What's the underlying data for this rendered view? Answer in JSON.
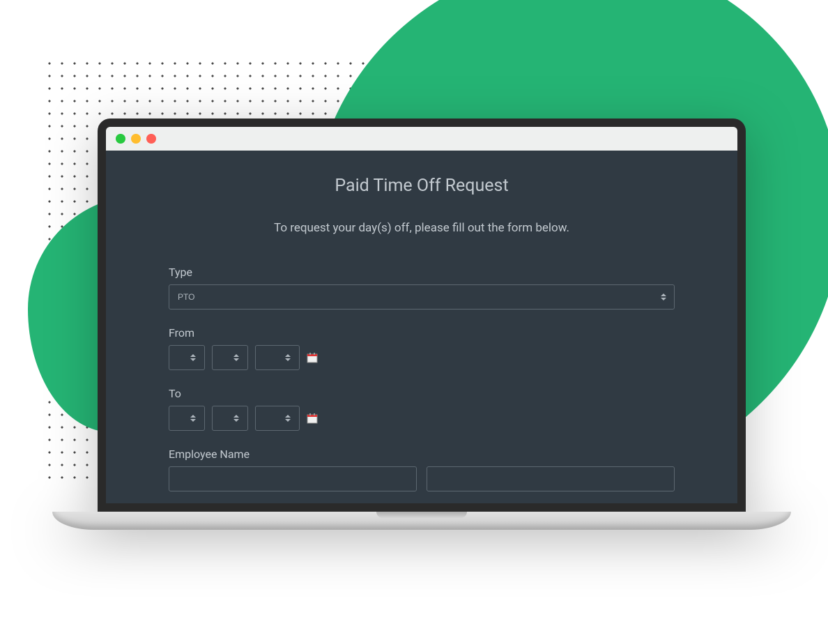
{
  "form": {
    "title": "Paid Time Off Request",
    "subtitle": "To request your day(s) off, please fill out the form below.",
    "type_label": "Type",
    "type_value": "PTO",
    "from_label": "From",
    "to_label": "To",
    "employee_name_label": "Employee Name"
  }
}
